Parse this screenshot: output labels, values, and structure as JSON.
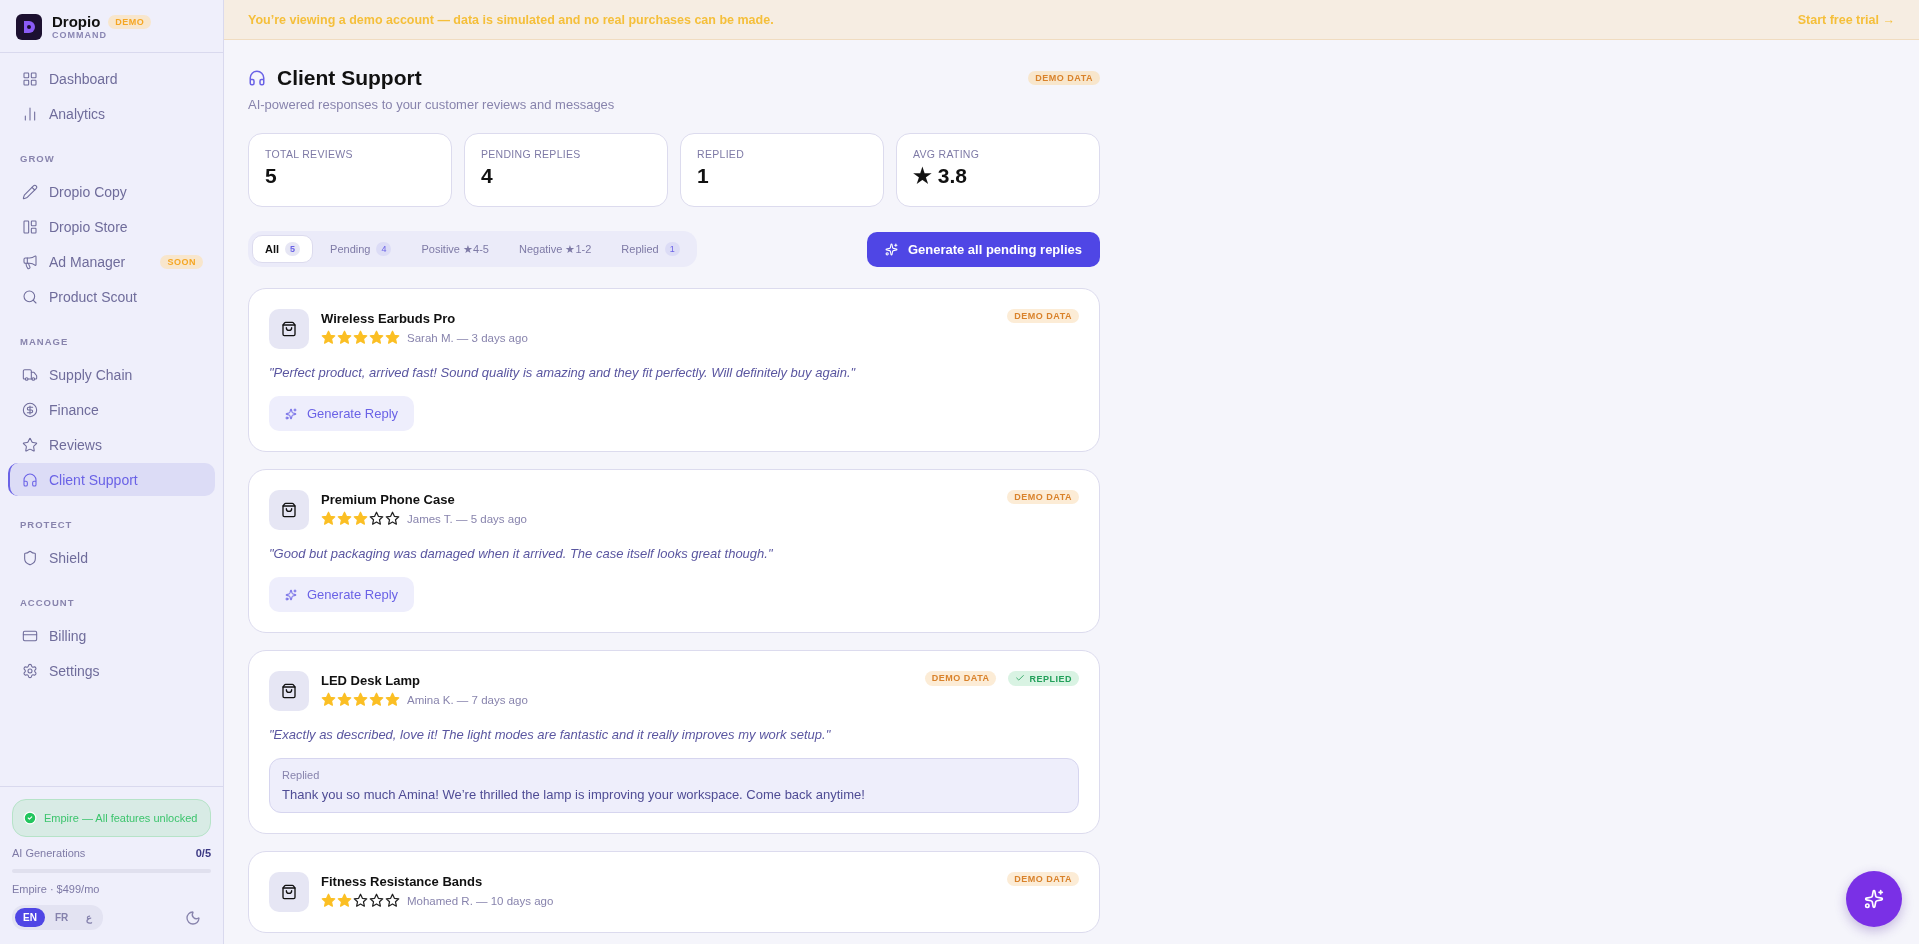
{
  "brand": {
    "name": "Dropio",
    "badge": "DEMO",
    "subtitle": "COMMAND"
  },
  "nav": [
    {
      "items": [
        {
          "label": "Dashboard",
          "selected": false
        },
        {
          "label": "Analytics",
          "selected": false
        }
      ]
    },
    {
      "heading": "GROW",
      "items": [
        {
          "label": "Dropio Copy",
          "selected": false
        },
        {
          "label": "Dropio Store",
          "selected": false
        },
        {
          "label": "Ad Manager",
          "selected": false,
          "badge": "SOON"
        },
        {
          "label": "Product Scout",
          "selected": false
        }
      ]
    },
    {
      "heading": "MANAGE",
      "items": [
        {
          "label": "Supply Chain",
          "selected": false
        },
        {
          "label": "Finance",
          "selected": false
        },
        {
          "label": "Reviews",
          "selected": false
        },
        {
          "label": "Client Support",
          "selected": true
        }
      ]
    },
    {
      "heading": "PROTECT",
      "items": [
        {
          "label": "Shield",
          "selected": false
        }
      ]
    },
    {
      "heading": "ACCOUNT",
      "items": [
        {
          "label": "Billing",
          "selected": false
        },
        {
          "label": "Settings",
          "selected": false
        }
      ]
    }
  ],
  "plan": {
    "status": "Empire — All features unlocked",
    "usage_label": "AI Generations",
    "usage_count": "0/5",
    "level": 0,
    "price": "Empire · $499/mo"
  },
  "languages": [
    {
      "label": "EN",
      "selected": true
    },
    {
      "label": "FR",
      "selected": false
    },
    {
      "label": "ع",
      "selected": false
    }
  ],
  "banner": {
    "text": "You’re viewing a demo account — data is simulated and no real purchases can be made.",
    "link": "Start free trial →"
  },
  "page": {
    "title": "Client Support",
    "subtitle": "AI-powered responses to your customer reviews and messages",
    "badge": "DEMO DATA"
  },
  "stats": [
    {
      "label": "TOTAL REVIEWS",
      "value": "5"
    },
    {
      "label": "PENDING REPLIES",
      "value": "4"
    },
    {
      "label": "REPLIED",
      "value": "1"
    },
    {
      "label": "AVG RATING",
      "value": "★ 3.8"
    }
  ],
  "filters": [
    {
      "label": "All",
      "count": "5",
      "selected": true
    },
    {
      "label": "Pending",
      "count": "4",
      "selected": false
    },
    {
      "label": "Positive ★4-5",
      "selected": false
    },
    {
      "label": "Negative ★1-2",
      "selected": false
    },
    {
      "label": "Replied",
      "count": "1",
      "selected": false
    }
  ],
  "generate_all_button": "Generate all pending replies",
  "reviews": [
    {
      "product": "Wireless Earbuds Pro",
      "stars": 5,
      "meta": "Sarah M. — 3 days ago",
      "badge": "DEMO DATA",
      "replied": false,
      "quote": "\"Perfect product, arrived fast! Sound quality is amazing and they fit perfectly. Will definitely buy again.\"",
      "action": "Generate Reply"
    },
    {
      "product": "Premium Phone Case",
      "stars": 3,
      "meta": "James T. — 5 days ago",
      "badge": "DEMO DATA",
      "replied": false,
      "quote": "\"Good but packaging was damaged when it arrived. The case itself looks great though.\"",
      "action": "Generate Reply"
    },
    {
      "product": "LED Desk Lamp",
      "stars": 5,
      "meta": "Amina K. — 7 days ago",
      "badge": "DEMO DATA",
      "replied": true,
      "status_label": "REPLIED",
      "quote": "\"Exactly as described, love it! The light modes are fantastic and it really improves my work setup.\"",
      "reply_label": "Replied",
      "reply": "Thank you so much Amina! We’re thrilled the lamp is improving your workspace. Come back anytime!"
    },
    {
      "product": "Fitness Resistance Bands",
      "stars": 2,
      "meta": "Mohamed R. — 10 days ago",
      "badge": "DEMO DATA",
      "replied": false
    }
  ]
}
